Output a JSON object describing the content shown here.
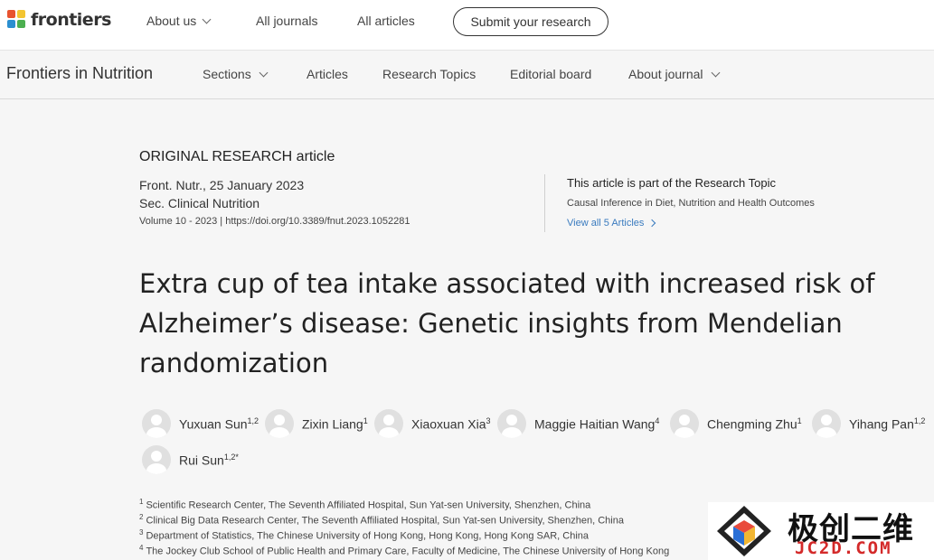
{
  "topbar": {
    "logo_text": "frontiers",
    "nav": [
      {
        "label": "About us"
      },
      {
        "label": "All journals"
      },
      {
        "label": "All articles"
      }
    ],
    "submit_label": "Submit your research"
  },
  "journalbar": {
    "title": "Frontiers in Nutrition",
    "nav": [
      {
        "label": "Sections"
      },
      {
        "label": "Articles"
      },
      {
        "label": "Research Topics"
      },
      {
        "label": "Editorial board"
      },
      {
        "label": "About journal"
      }
    ]
  },
  "article": {
    "type": "ORIGINAL RESEARCH article",
    "journal_date": "Front. Nutr., 25 January 2023",
    "section": "Sec. Clinical Nutrition",
    "volume_doi": "Volume 10 - 2023 | https://doi.org/10.3389/fnut.2023.1052281",
    "research_topic": {
      "label": "This article is part of the Research Topic",
      "name": "Causal Inference in Diet, Nutrition and Health Outcomes",
      "link": "View all 5 Articles"
    },
    "title_lines": [
      "Extra cup of tea intake associated with increased risk of",
      "Alzheimer’s disease: Genetic insights from Mendelian",
      "randomization"
    ],
    "authors": [
      {
        "name": "Yuxuan Sun",
        "sup": "1,2"
      },
      {
        "name": "Zixin Liang",
        "sup": "1"
      },
      {
        "name": "Xiaoxuan Xia",
        "sup": "3"
      },
      {
        "name": "Maggie Haitian Wang",
        "sup": "4"
      },
      {
        "name": "Chengming Zhu",
        "sup": "1"
      },
      {
        "name": "Yihang Pan",
        "sup": "1,2"
      },
      {
        "name": "Rui Sun",
        "sup": "1,2*"
      }
    ],
    "affiliations": [
      {
        "num": "1",
        "text": "Scientific Research Center, The Seventh Affiliated Hospital, Sun Yat-sen University, Shenzhen, China"
      },
      {
        "num": "2",
        "text": "Clinical Big Data Research Center, The Seventh Affiliated Hospital, Sun Yat-sen University, Shenzhen, China"
      },
      {
        "num": "3",
        "text": "Department of Statistics, The Chinese University of Hong Kong, Hong Kong, Hong Kong SAR, China"
      },
      {
        "num": "4",
        "text": "The Jockey Club School of Public Health and Primary Care, Faculty of Medicine, The Chinese University of Hong Kong"
      }
    ]
  },
  "watermark": {
    "cn": "极创二维",
    "en": "JC2D.COM"
  }
}
